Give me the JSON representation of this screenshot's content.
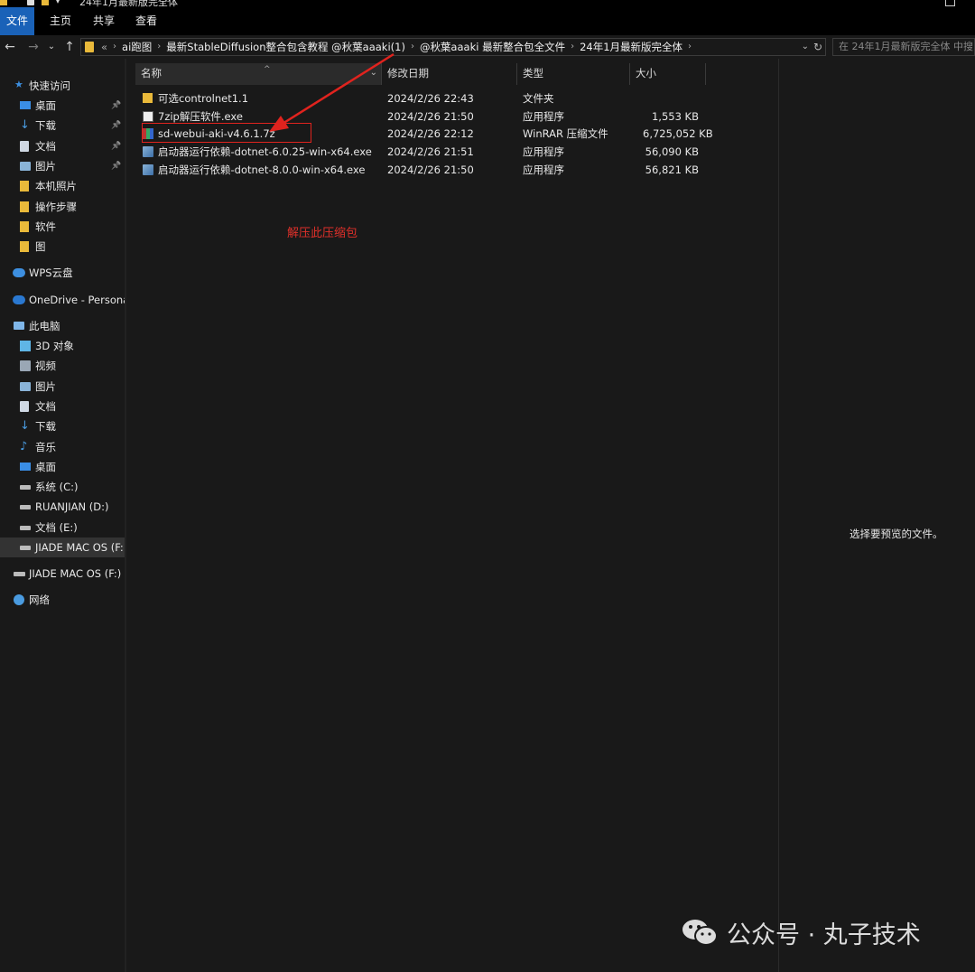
{
  "titlebar": {
    "title": "24年1月最新版完全体"
  },
  "ribbon": {
    "tabs": [
      "文件",
      "主页",
      "共享",
      "查看"
    ]
  },
  "address": {
    "overflow": "«",
    "crumbs": [
      "ai跑图",
      "最新StableDiffusion整合包含教程 @秋葉aaaki(1)",
      "@秋葉aaaki 最新整合包全文件",
      "24年1月最新版完全体"
    ],
    "search_placeholder": "在 24年1月最新版完全体 中搜"
  },
  "sidebar": {
    "quick_access": "快速访问",
    "quick_items": [
      {
        "label": "桌面",
        "icon": "desktop-icon"
      },
      {
        "label": "下载",
        "icon": "download-icon"
      },
      {
        "label": "文档",
        "icon": "document-icon"
      },
      {
        "label": "图片",
        "icon": "picture-icon"
      },
      {
        "label": "本机照片",
        "icon": "folder-icon"
      },
      {
        "label": "操作步骤",
        "icon": "folder-icon"
      },
      {
        "label": "软件",
        "icon": "folder-icon"
      },
      {
        "label": "图",
        "icon": "folder-icon"
      }
    ],
    "wps": "WPS云盘",
    "onedrive": "OneDrive - Persona",
    "this_pc": "此电脑",
    "pc_items": [
      {
        "label": "3D 对象",
        "icon": "cube-icon"
      },
      {
        "label": "视频",
        "icon": "video-icon"
      },
      {
        "label": "图片",
        "icon": "picture-icon"
      },
      {
        "label": "文档",
        "icon": "document-icon"
      },
      {
        "label": "下载",
        "icon": "download-icon"
      },
      {
        "label": "音乐",
        "icon": "music-icon"
      },
      {
        "label": "桌面",
        "icon": "desktop-icon"
      },
      {
        "label": "系统 (C:)",
        "icon": "drive-icon"
      },
      {
        "label": "RUANJIAN (D:)",
        "icon": "drive-icon"
      },
      {
        "label": "文档 (E:)",
        "icon": "drive-icon"
      },
      {
        "label": "JIADE  MAC OS (F:",
        "icon": "drive-icon"
      }
    ],
    "external_drive": "JIADE  MAC OS (F:)",
    "network": "网络"
  },
  "columns": {
    "name": "名称",
    "date": "修改日期",
    "type": "类型",
    "size": "大小"
  },
  "files": [
    {
      "name": "可选controlnet1.1",
      "date": "2024/2/26 22:43",
      "type": "文件夹",
      "size": "",
      "icon": "folder-icon"
    },
    {
      "name": "7zip解压软件.exe",
      "date": "2024/2/26 21:50",
      "type": "应用程序",
      "size": "1,553 KB",
      "icon": "7zip-icon"
    },
    {
      "name": "sd-webui-aki-v4.6.1.7z",
      "date": "2024/2/26 22:12",
      "type": "WinRAR 压缩文件",
      "size": "6,725,052 KB",
      "icon": "winrar-icon"
    },
    {
      "name": "启动器运行依赖-dotnet-6.0.25-win-x64.exe",
      "date": "2024/2/26 21:51",
      "type": "应用程序",
      "size": "56,090 KB",
      "icon": "installer-icon"
    },
    {
      "name": "启动器运行依赖-dotnet-8.0.0-win-x64.exe",
      "date": "2024/2/26 21:50",
      "type": "应用程序",
      "size": "56,821 KB",
      "icon": "installer-icon"
    }
  ],
  "annotation": {
    "text": "解压此压缩包",
    "color": "#e0231e"
  },
  "preview": {
    "text": "选择要预览的文件。"
  },
  "watermark": {
    "text": "公众号 · 丸子技术"
  },
  "colors": {
    "ribbon_active": "#1a62b8",
    "background": "#191919",
    "folder": "#e9b93a"
  }
}
